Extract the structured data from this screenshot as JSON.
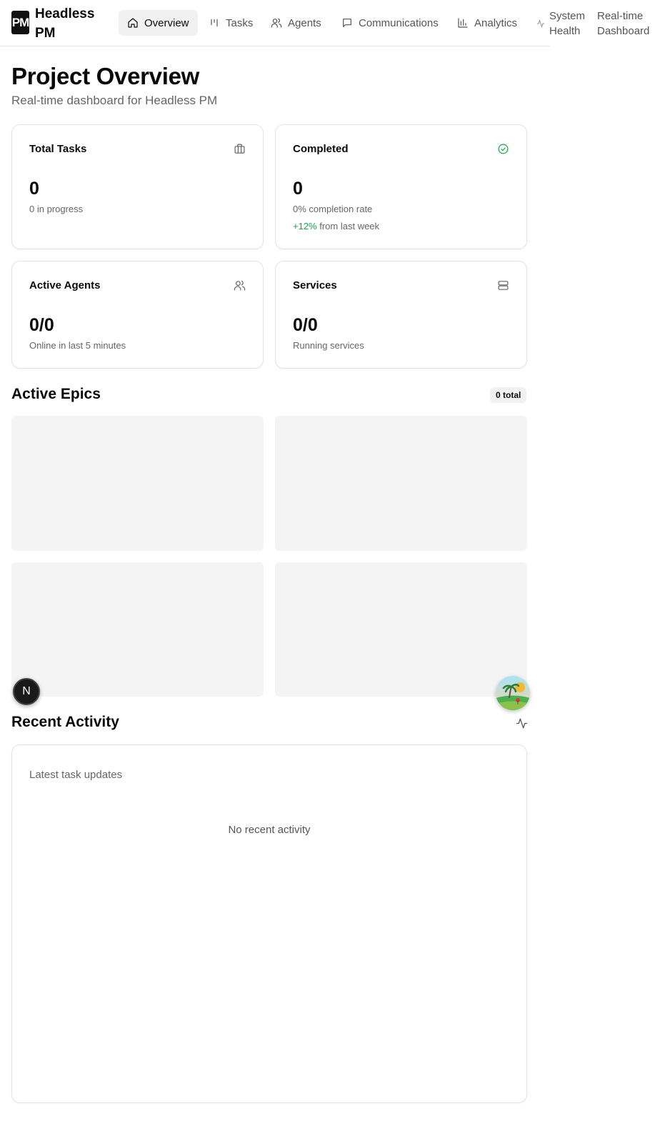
{
  "header": {
    "logo_text": "PM",
    "brand": "Headless PM",
    "nav": [
      {
        "label": "Overview",
        "icon": "home-icon",
        "active": true
      },
      {
        "label": "Tasks",
        "icon": "kanban-icon",
        "active": false
      },
      {
        "label": "Agents",
        "icon": "users-icon",
        "active": false
      },
      {
        "label": "Communications",
        "icon": "message-icon",
        "active": false
      },
      {
        "label": "Analytics",
        "icon": "bar-chart-icon",
        "active": false
      },
      {
        "label": "System Health",
        "icon": "activity-icon",
        "active": false
      },
      {
        "label": "Real-time Dashboard",
        "icon": "",
        "active": false
      }
    ]
  },
  "main": {
    "title": "Project Overview",
    "subtitle": "Real-time dashboard for Headless PM",
    "stats": [
      {
        "title": "Total Tasks",
        "icon": "briefcase-icon",
        "value": "0",
        "sub": "0 in progress"
      },
      {
        "title": "Completed",
        "icon": "check-circle-icon",
        "value": "0",
        "sub": "0% completion rate",
        "trend_value": "+12%",
        "trend_text": " from last week"
      },
      {
        "title": "Active Agents",
        "icon": "users-icon",
        "value": "0/0",
        "sub": "Online in last 5 minutes"
      },
      {
        "title": "Services",
        "icon": "server-icon",
        "value": "0/0",
        "sub": "Running services"
      }
    ],
    "epics": {
      "title": "Active Epics",
      "badge": "0 total"
    },
    "activity": {
      "title": "Recent Activity",
      "icon": "activity-icon",
      "description": "Latest task updates",
      "empty": "No recent activity"
    }
  },
  "overlays": {
    "dev_badge_letter": "N",
    "accent_green": "#16a34a"
  }
}
